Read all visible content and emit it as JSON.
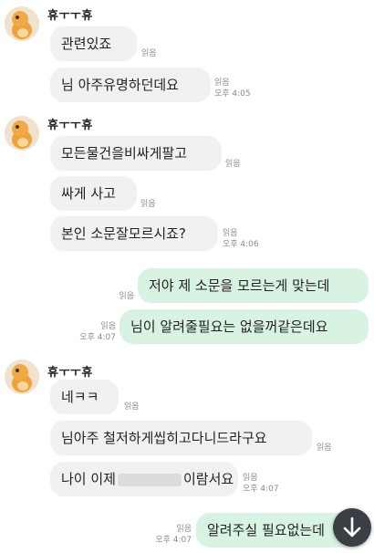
{
  "sender_name": "휴ㅜㅜ휴",
  "read_label": "읽음",
  "messages": [
    {
      "text": "관련있죠",
      "read": "읽음"
    },
    {
      "text": "님 아주유명하던데요",
      "read": "읽음",
      "time": "오후 4:05"
    },
    {
      "text": "모든물건을비싸게팔고",
      "read": "읽음"
    },
    {
      "text": "싸게 사고",
      "read": "읽음"
    },
    {
      "text": "본인 소문잘모르시죠?",
      "read": "읽음",
      "time": "오후 4:06"
    },
    {
      "text": "저야 제 소문을 모르는게 맞는데",
      "read": "읽음"
    },
    {
      "text": "님이 알려줄필요는 없을꺼같은데요",
      "read": "읽음",
      "time": "오후 4:07"
    },
    {
      "text": "네ㅋㅋ",
      "read": "읽음"
    },
    {
      "text": "님아주 철저하게씹히고다니드라구요",
      "read": "읽음"
    },
    {
      "text_before": "나이 이제",
      "text_after": "이람서요",
      "read": "읽음",
      "time": "오후 4:07"
    },
    {
      "text": "알려주실 필요없는데",
      "read": "읽음",
      "time": "오후 4:07"
    }
  ],
  "scroll_button_icon": "arrow-down-icon",
  "colors": {
    "incoming": "#f1f1f1",
    "outgoing": "#d9f3e2",
    "scroll_button": "#3b3f45"
  }
}
